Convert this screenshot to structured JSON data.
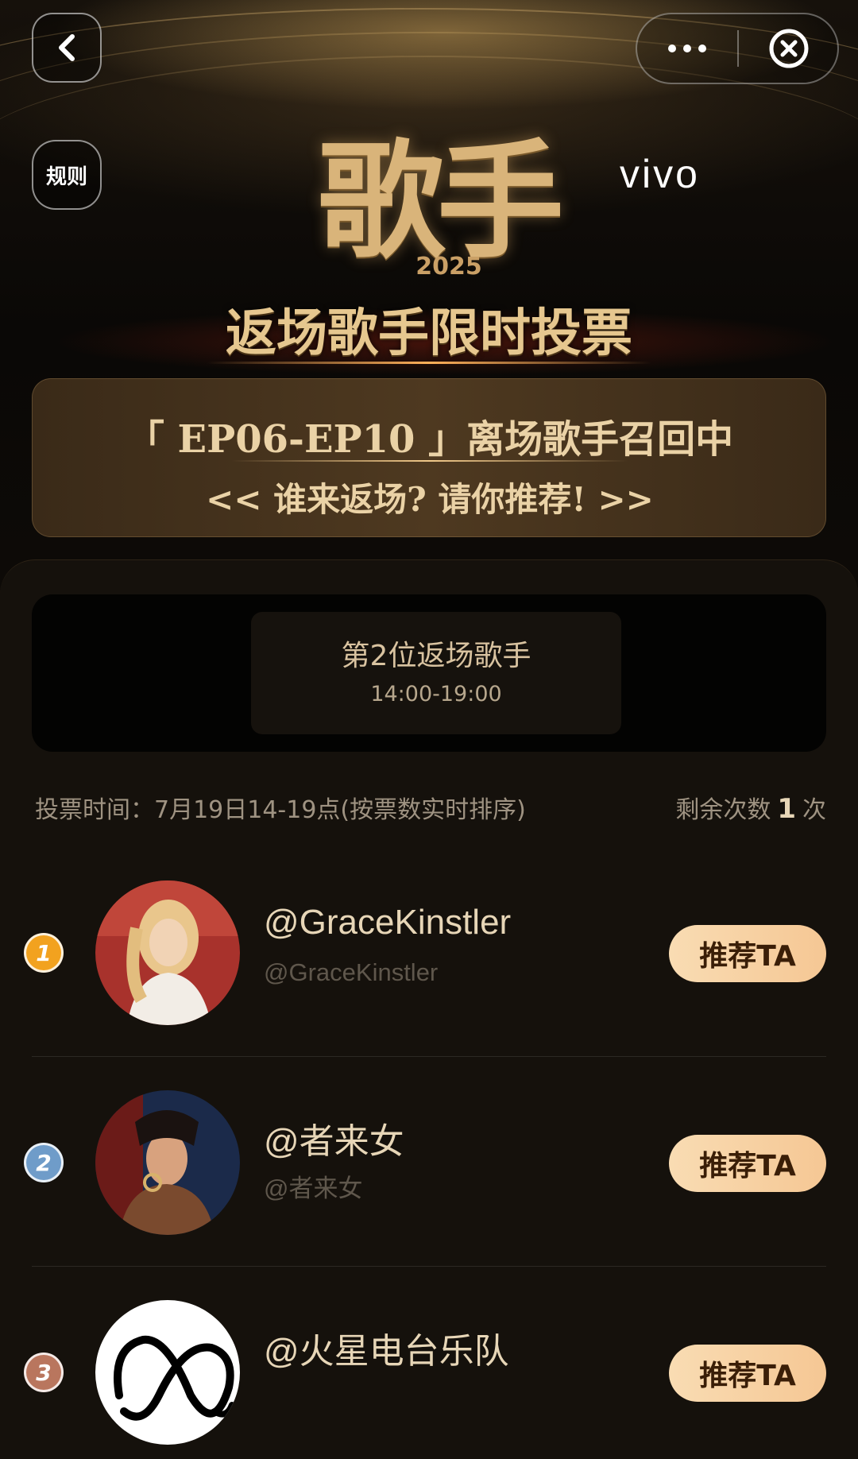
{
  "nav": {
    "rules_label": "规则"
  },
  "hero": {
    "logo_text": "歌手",
    "logo_year": "2025",
    "brand": "vivo",
    "title": "返场歌手限时投票",
    "banner_line1": "「 EP06-EP10 」离场歌手召回中",
    "banner_line2": "<< 谁来返场? 请你推荐! >>"
  },
  "round": {
    "title": "第2位返场歌手",
    "time": "14:00-19:00"
  },
  "vote_info": {
    "time_text": "投票时间：7月19日14-19点(按票数实时排序)",
    "remaining_label": "剩余次数",
    "remaining_count": "1",
    "remaining_unit": "次"
  },
  "singers": [
    {
      "rank": "1",
      "rank_color": "#f2a21f",
      "name": "@GraceKinstler",
      "handle": "@GraceKinstler",
      "button": "推荐TA"
    },
    {
      "rank": "2",
      "rank_color": "#6f9cc9",
      "name": "@者来女",
      "handle": "@者来女",
      "button": "推荐TA"
    },
    {
      "rank": "3",
      "rank_color": "#b9765e",
      "name": "@火星电台乐队",
      "handle": "",
      "button": "推荐TA"
    }
  ],
  "icons": {
    "back": "chevron-left-icon",
    "more": "more-dots-icon",
    "close": "close-circle-icon"
  }
}
